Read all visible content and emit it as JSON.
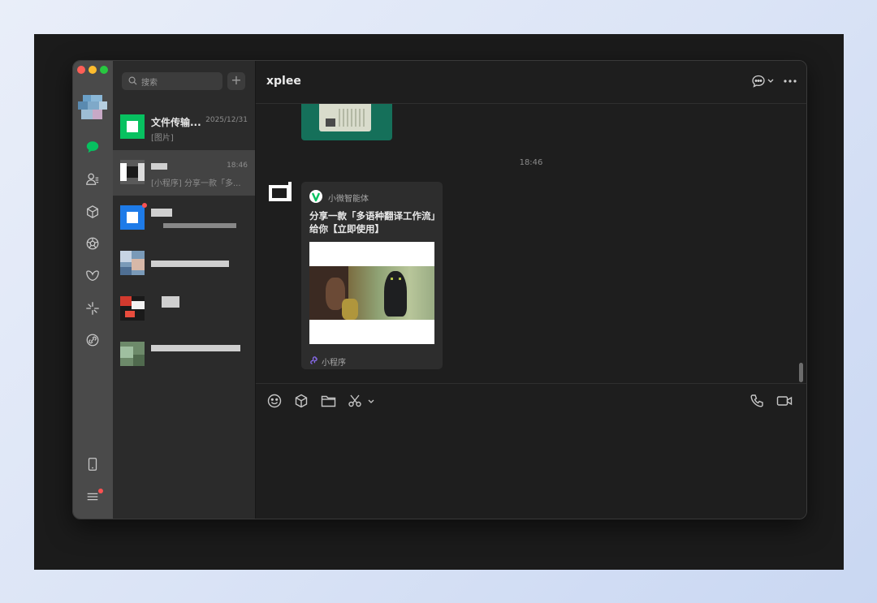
{
  "sidebar": {
    "icons": [
      "chat-icon",
      "contacts-icon",
      "cube-icon",
      "aperture-icon",
      "butterfly-icon",
      "sparkle-icon",
      "link-icon",
      "phone-device-icon",
      "menu-icon"
    ],
    "accent": "#07c160"
  },
  "search": {
    "placeholder": "搜索"
  },
  "chats": [
    {
      "name": "文件传输...",
      "time": "2025/12/31",
      "preview": "[图片]"
    },
    {
      "time": "18:46",
      "preview": "[小程序] 分享一款「多..."
    }
  ],
  "conversation": {
    "title": "xplee",
    "timestamp": "18:46",
    "card": {
      "source": "小微智能体",
      "title": "分享一款「多语种翻译工作流」给你【立即使用】",
      "tag": "小程序"
    }
  },
  "toolbar": {
    "icons": [
      "emoji-icon",
      "cube-icon",
      "folder-icon",
      "scissors-icon",
      "phone-icon",
      "video-icon"
    ]
  }
}
